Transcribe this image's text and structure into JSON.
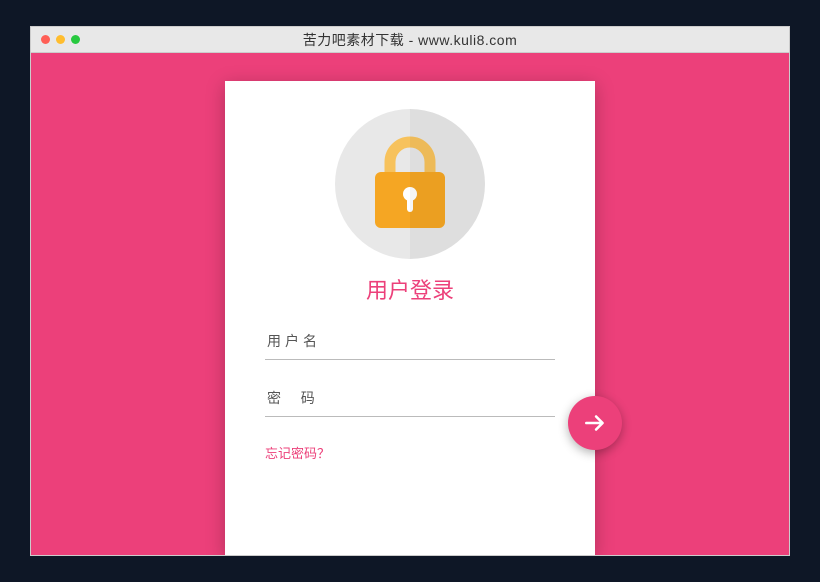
{
  "window": {
    "title": "苦力吧素材下载 - www.kuli8.com"
  },
  "login": {
    "heading": "用户登录",
    "username_placeholder": "用户名",
    "password_placeholder": "密  码",
    "forgot_text": "忘记密码？"
  },
  "colors": {
    "accent": "#ec407a",
    "lock_body": "#f5a623",
    "lock_shackle": "#f7c25c"
  }
}
